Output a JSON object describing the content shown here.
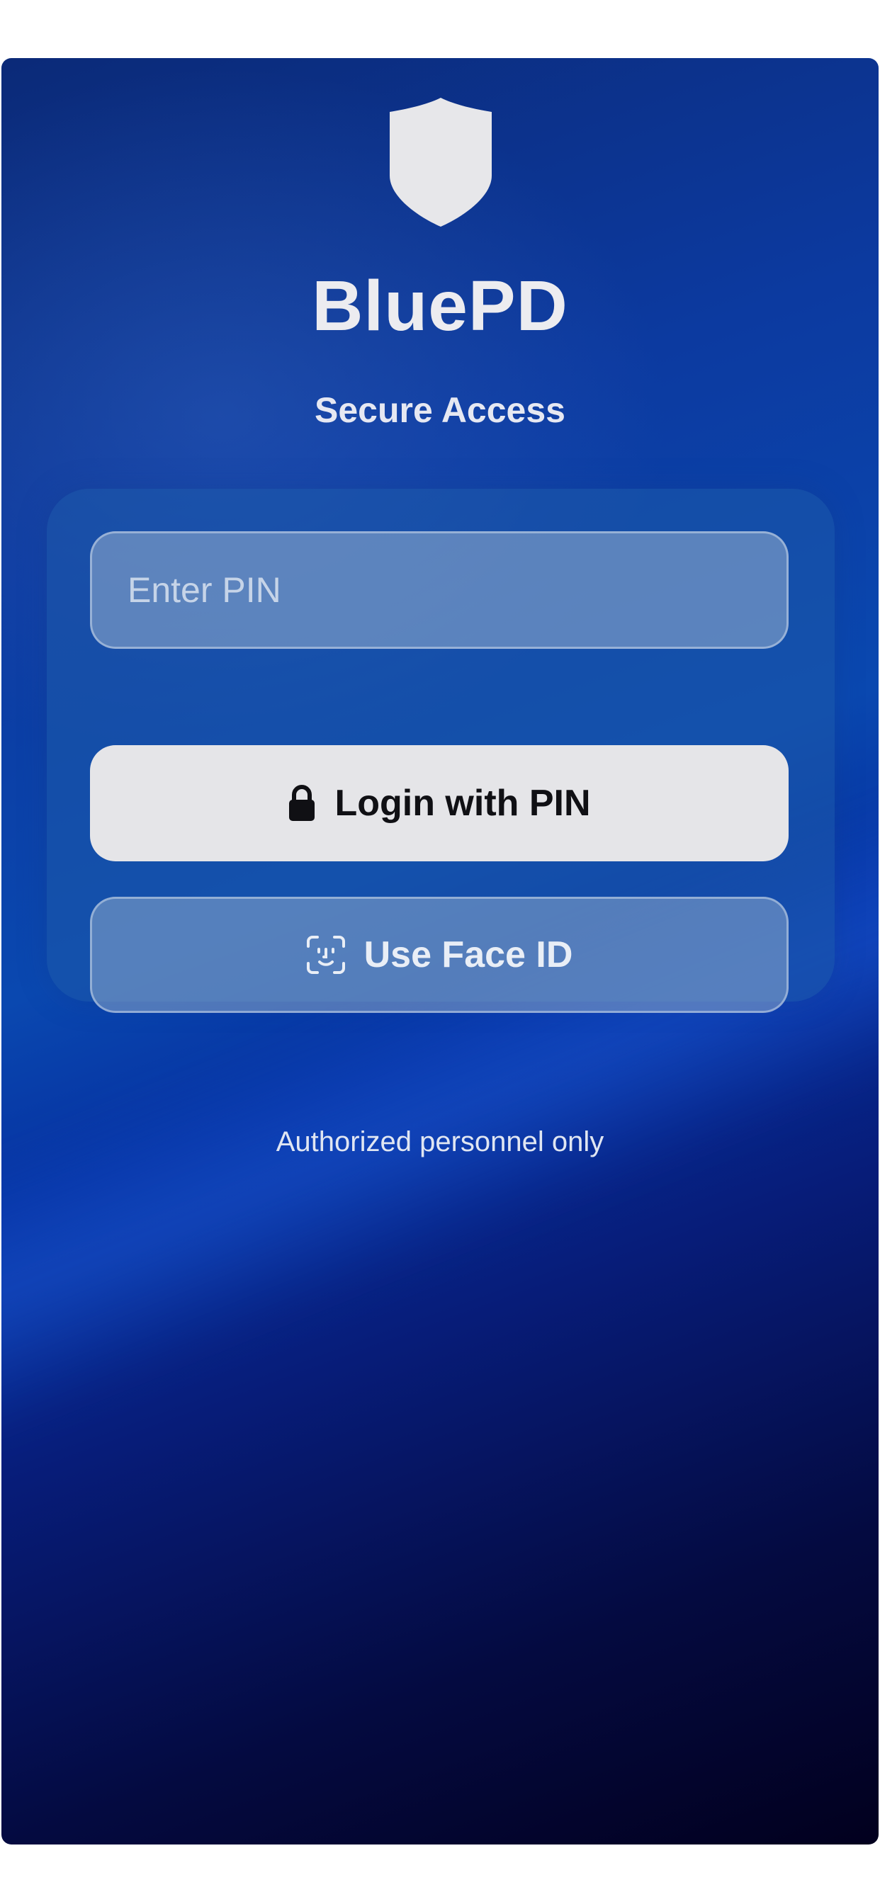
{
  "app": {
    "title": "BluePD",
    "subtitle": "Secure Access",
    "logo_icon": "shield-icon"
  },
  "login": {
    "pin_placeholder": "Enter PIN",
    "pin_value": "",
    "login_button_label": "Login with PIN",
    "login_button_icon": "lock-icon",
    "face_id_button_label": "Use Face ID",
    "face_id_button_icon": "face-id-icon"
  },
  "footer": {
    "note": "Authorized personnel only"
  },
  "colors": {
    "background_top": "#0b2a78",
    "background_bottom": "#02001e",
    "primary_button": "#e5e5e8",
    "text_light": "#ececf0"
  }
}
